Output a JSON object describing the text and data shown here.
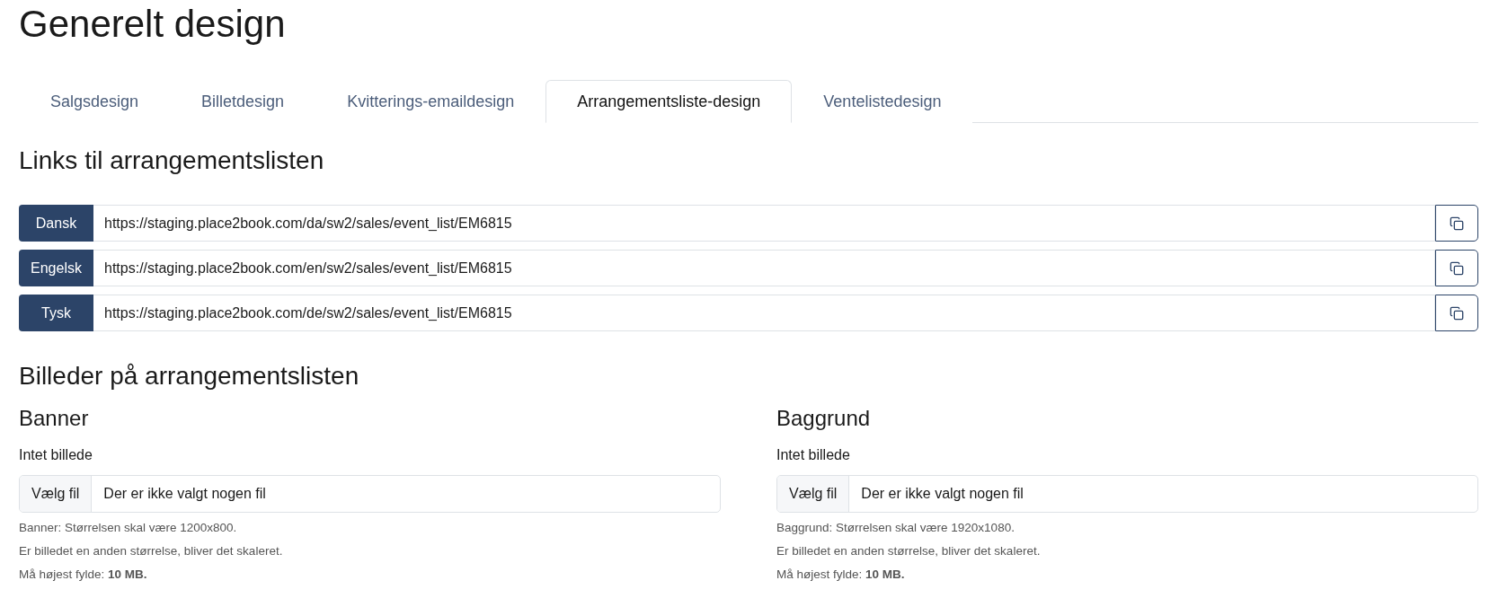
{
  "page_title": "Generelt design",
  "tabs": [
    {
      "label": "Salgsdesign",
      "selected": false
    },
    {
      "label": "Billetdesign",
      "selected": false
    },
    {
      "label": "Kvitterings-emaildesign",
      "selected": false
    },
    {
      "label": "Arrangementsliste-design",
      "selected": true
    },
    {
      "label": "Ventelistedesign",
      "selected": false
    }
  ],
  "links_section": {
    "heading": "Links til arrangementslisten",
    "links": [
      {
        "language": "Dansk",
        "url": "https://staging.place2book.com/da/sw2/sales/event_list/EM6815"
      },
      {
        "language": "Engelsk",
        "url": "https://staging.place2book.com/en/sw2/sales/event_list/EM6815"
      },
      {
        "language": "Tysk",
        "url": "https://staging.place2book.com/de/sw2/sales/event_list/EM6815"
      }
    ]
  },
  "images_section": {
    "heading": "Billeder på arrangementslisten",
    "images": [
      {
        "title": "Banner",
        "status": "Intet billede",
        "file_button": "Vælg fil",
        "file_status": "Der er ikke valgt nogen fil",
        "hints": [
          "Banner: Størrelsen skal være 1200x800.",
          "Er billedet en anden størrelse, bliver det skaleret.",
          "Må højest fylde: **10 MB.**"
        ]
      },
      {
        "title": "Baggrund",
        "status": "Intet billede",
        "file_button": "Vælg fil",
        "file_status": "Der er ikke valgt nogen fil",
        "hints": [
          "Baggrund: Størrelsen skal være 1920x1080.",
          "Er billedet en anden størrelse, bliver det skaleret.",
          "Må højest fylde: **10 MB.**"
        ]
      }
    ]
  }
}
